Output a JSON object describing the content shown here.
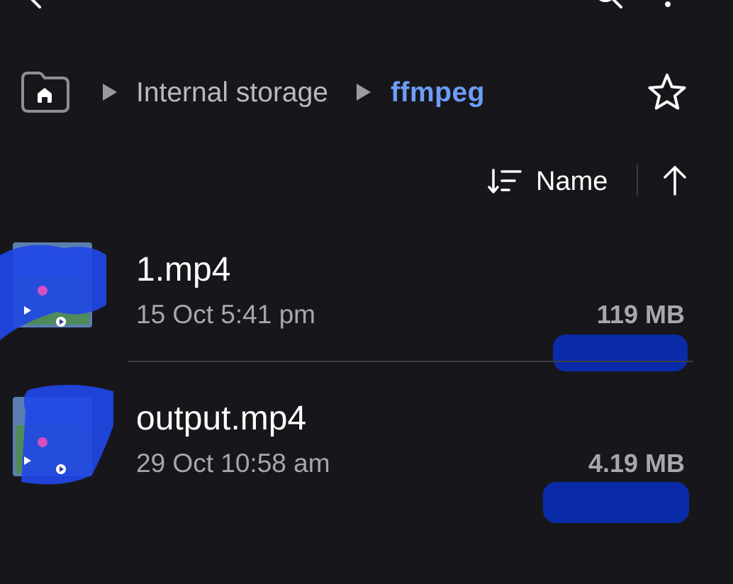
{
  "topbar": {
    "back_icon": "chevron-left-icon",
    "search_icon": "search-icon",
    "more_icon": "more-vert-icon"
  },
  "breadcrumb": {
    "home_icon": "folder-home-icon",
    "separator_icon": "triangle-right-icon",
    "items": [
      {
        "label": "Internal storage",
        "active": false
      },
      {
        "label": "ffmpeg",
        "active": true
      }
    ],
    "favorite_icon": "star-outline-icon"
  },
  "sort": {
    "icon": "sort-icon",
    "label": "Name",
    "direction_icon": "arrow-up-icon"
  },
  "files": [
    {
      "name": "1.mp4",
      "date": "15 Oct 5:41 pm",
      "size": "119 MB",
      "icon": "video-thumbnail"
    },
    {
      "name": "output.mp4",
      "date": "29 Oct 10:58 am",
      "size": "4.19 MB",
      "icon": "video-thumbnail"
    }
  ],
  "colors": {
    "background": "#17171b",
    "accent": "#6d9df8",
    "primary_text": "#ffffff",
    "secondary_text": "#a7a7ad",
    "redaction": "#0a2ba8"
  }
}
